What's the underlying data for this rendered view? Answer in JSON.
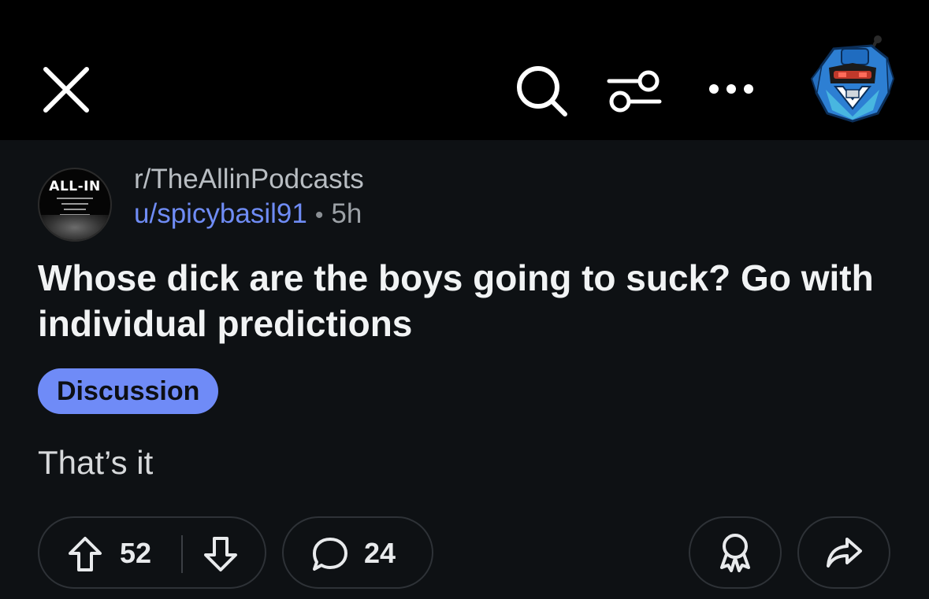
{
  "topbar": {
    "close_icon": "close-icon",
    "search_icon": "search-icon",
    "filter_icon": "sliders-icon",
    "more_icon": "more-horizontal-icon",
    "user_avatar": "robot-avatar"
  },
  "post": {
    "subreddit": "r/TheAllinPodcasts",
    "subreddit_logo_text": "ALL-IN",
    "author": "u/spicybasil91",
    "separator": "•",
    "age": "5h",
    "title": "Whose dick are the boys going to suck? Go with individual predictions",
    "flair": "Discussion",
    "body": "That’s it"
  },
  "actions": {
    "upvotes": "52",
    "comments": "24",
    "award_icon": "award-icon",
    "share_icon": "share-icon"
  },
  "colors": {
    "topbar_bg": "#000000",
    "page_bg": "#0e1114",
    "link_blue": "#6f8cf5",
    "flair_bg": "#6f8bf7",
    "text_primary": "#f1f3f4"
  }
}
